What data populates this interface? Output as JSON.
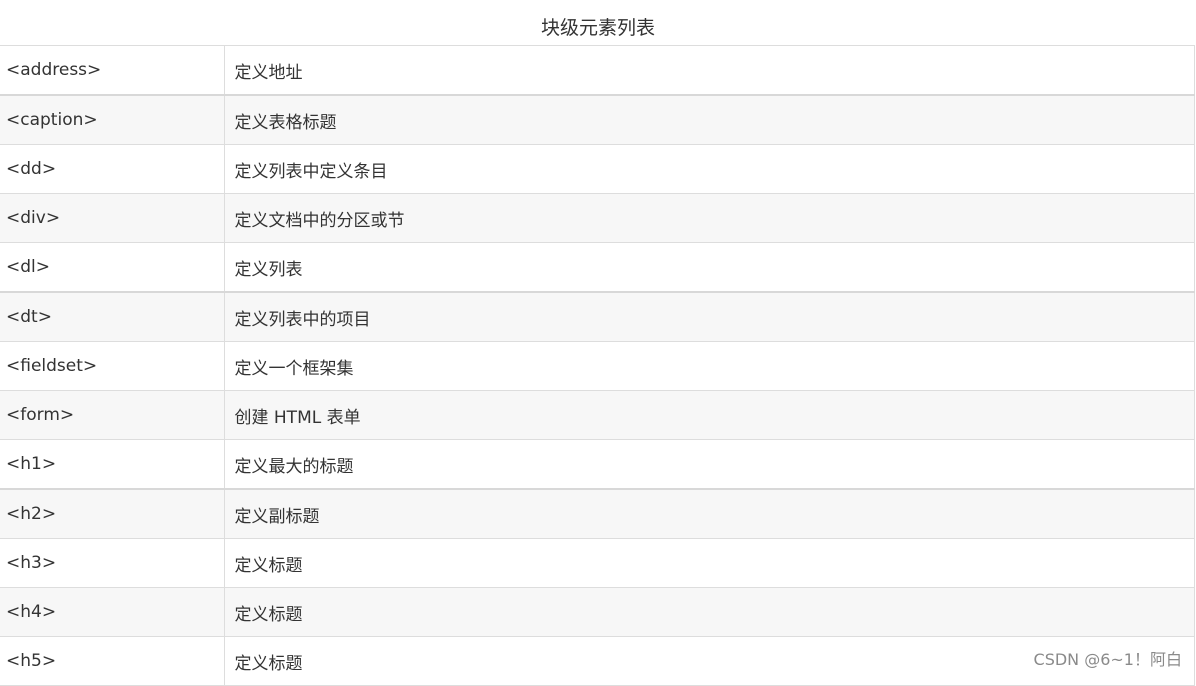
{
  "table": {
    "caption": "块级元素列表",
    "rows": [
      {
        "tag": "<address>",
        "desc": "定义地址"
      },
      {
        "tag": "<caption>",
        "desc": "定义表格标题"
      },
      {
        "tag": "<dd>",
        "desc": "定义列表中定义条目"
      },
      {
        "tag": "<div>",
        "desc": "定义文档中的分区或节"
      },
      {
        "tag": "<dl>",
        "desc": "定义列表"
      },
      {
        "tag": "<dt>",
        "desc": "定义列表中的项目"
      },
      {
        "tag": "<fieldset>",
        "desc": "定义一个框架集"
      },
      {
        "tag": "<form>",
        "desc": "创建 HTML 表单"
      },
      {
        "tag": "<h1>",
        "desc": "定义最大的标题"
      },
      {
        "tag": "<h2>",
        "desc": "定义副标题"
      },
      {
        "tag": "<h3>",
        "desc": "定义标题"
      },
      {
        "tag": "<h4>",
        "desc": "定义标题"
      },
      {
        "tag": "<h5>",
        "desc": "定义标题"
      }
    ]
  },
  "watermark": "CSDN @6~1！阿白",
  "colors": {
    "text": "#333333",
    "border": "#dddddd",
    "row_alt": "#f7f7f7",
    "watermark": "#8a8a8a"
  }
}
